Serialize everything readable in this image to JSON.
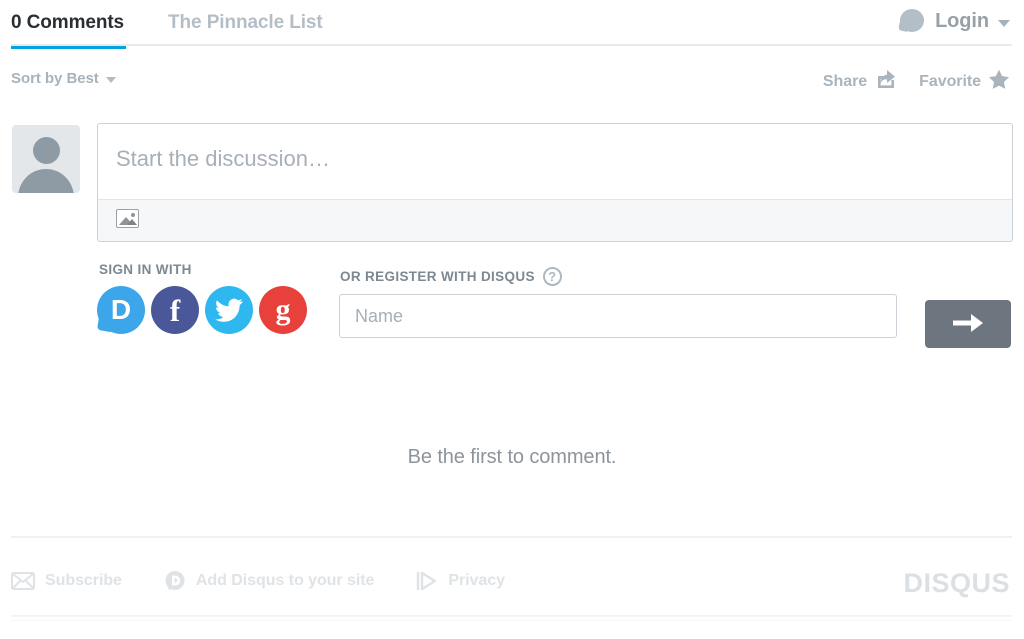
{
  "header": {
    "tab_comments": "0 Comments",
    "tab_site": "The Pinnacle List",
    "login_label": "Login",
    "active_tab_color": "#00a2e0"
  },
  "sortbar": {
    "sort_label": "Sort by Best",
    "share_label": "Share",
    "favorite_label": "Favorite"
  },
  "composer": {
    "placeholder": "Start the discussion…",
    "value": "",
    "avatar_alt": "default-avatar"
  },
  "auth": {
    "signin_label": "SIGN IN WITH",
    "register_label": "OR REGISTER WITH DISQUS",
    "help_glyph": "?",
    "name_placeholder": "Name",
    "name_value": "",
    "submit_glyph": "→",
    "providers": [
      {
        "name": "disqus",
        "glyph": "D",
        "color": "#3da6ea"
      },
      {
        "name": "facebook",
        "glyph": "f",
        "color": "#4a5798"
      },
      {
        "name": "twitter",
        "glyph": "",
        "color": "#2fb8ef"
      },
      {
        "name": "google",
        "glyph": "g",
        "color": "#e8403a"
      }
    ]
  },
  "empty_state": {
    "message": "Be the first to comment."
  },
  "footer": {
    "links": [
      {
        "label": "Subscribe",
        "icon": "envelope-icon"
      },
      {
        "label": "Add Disqus to your site",
        "icon": "disqus-bubble-icon"
      },
      {
        "label": "Privacy",
        "icon": "privacy-adchoices-icon"
      }
    ],
    "brand": "DISQUS"
  }
}
